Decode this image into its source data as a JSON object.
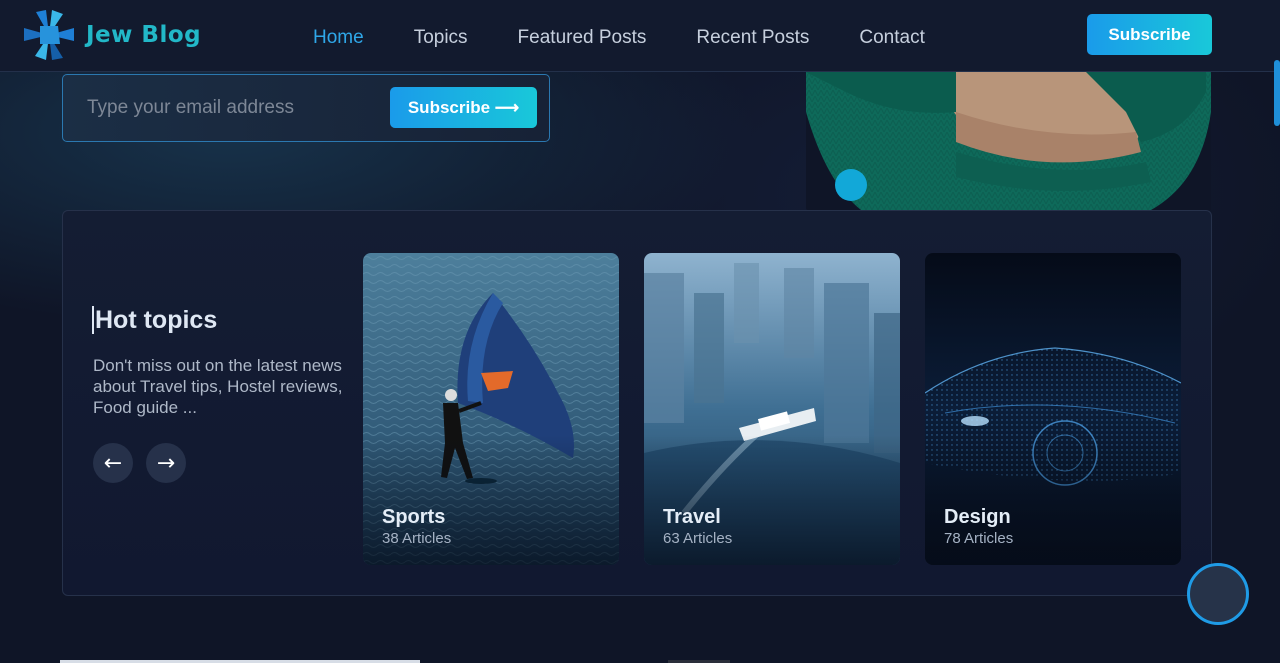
{
  "brand": {
    "name": "Jew Blog"
  },
  "nav": {
    "items": [
      {
        "label": "Home",
        "active": true
      },
      {
        "label": "Topics",
        "active": false
      },
      {
        "label": "Featured Posts",
        "active": false
      },
      {
        "label": "Recent Posts",
        "active": false
      },
      {
        "label": "Contact",
        "active": false
      }
    ],
    "subscribe_label": "Subscribe"
  },
  "newsletter": {
    "placeholder": "Type your email address",
    "button_label": "Subscribe ⟶"
  },
  "hot_topics": {
    "title": "Hot topics",
    "description": "Don't miss out on the latest news about Travel tips, Hostel reviews, Food guide ...",
    "prev_icon": "←",
    "next_icon": "→",
    "topics": [
      {
        "name": "Sports",
        "count": "38 Articles"
      },
      {
        "name": "Travel",
        "count": "63 Articles"
      },
      {
        "name": "Design",
        "count": "78 Articles"
      }
    ]
  },
  "colors": {
    "accent": "#1a9bea",
    "accent_alt": "#19c8d9",
    "brand_text": "#22b8c8",
    "background": "#0f1527"
  },
  "icons": {
    "logo": "crystal-logo-icon",
    "prev": "arrow-left-icon",
    "next": "arrow-right-icon",
    "back_to_top": "circle-button-icon"
  }
}
